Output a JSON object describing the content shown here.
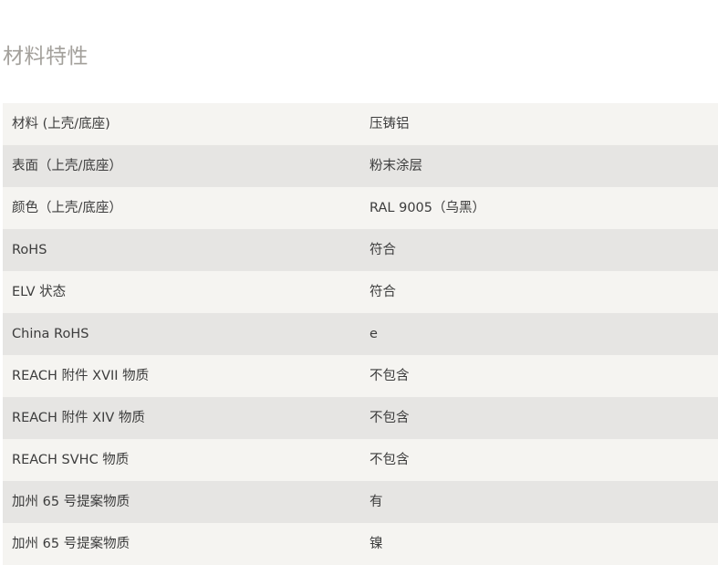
{
  "section": {
    "title": "材料特性"
  },
  "properties": [
    {
      "label": "材料 (上壳/底座)",
      "value": "压铸铝"
    },
    {
      "label": "表面（上壳/底座）",
      "value": "粉末涂层"
    },
    {
      "label": "颜色（上壳/底座）",
      "value": "RAL 9005（乌黑）"
    },
    {
      "label": "RoHS",
      "value": "符合"
    },
    {
      "label": "ELV 状态",
      "value": "符合"
    },
    {
      "label": "China RoHS",
      "value": "e"
    },
    {
      "label": "REACH 附件 XVII 物质",
      "value": "不包含"
    },
    {
      "label": "REACH 附件 XIV 物质",
      "value": "不包含"
    },
    {
      "label": "REACH SVHC 物质",
      "value": "不包含"
    },
    {
      "label": "加州 65 号提案物质",
      "value": "有"
    },
    {
      "label": "加州 65 号提案物质",
      "value": "镍"
    }
  ]
}
